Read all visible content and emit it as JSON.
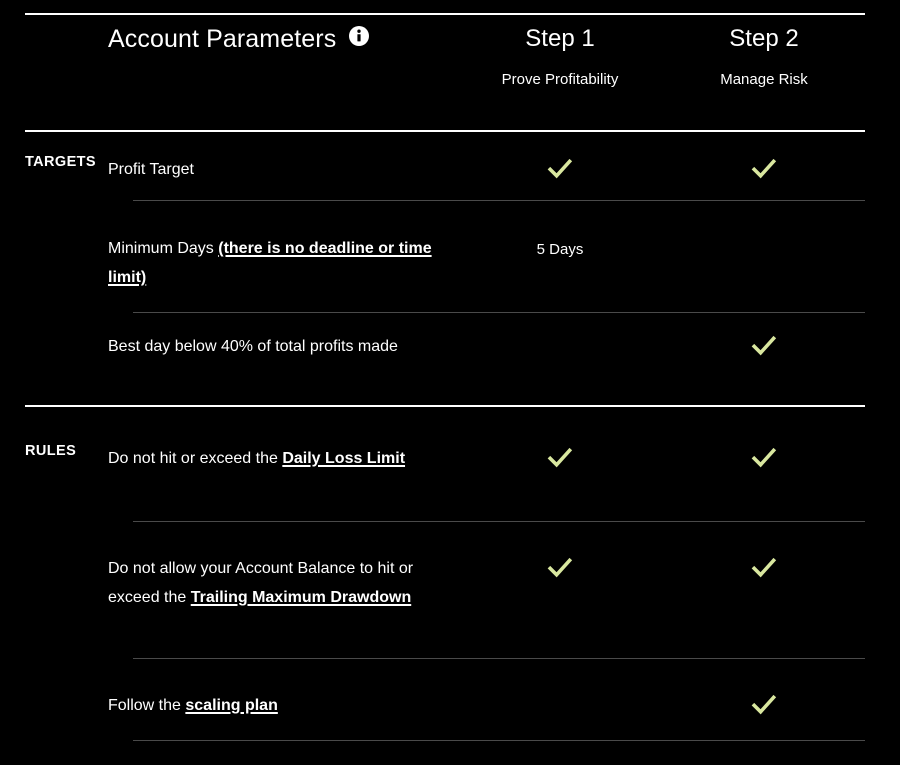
{
  "header": {
    "title": "Account Parameters",
    "info_icon": "info-icon",
    "columns": [
      {
        "title": "Step 1",
        "subtitle": "Prove Profitability"
      },
      {
        "title": "Step 2",
        "subtitle": "Manage Risk"
      }
    ]
  },
  "colors": {
    "background": "#000000",
    "text": "#ffffff",
    "check": "#d9e79f",
    "rule_bright": "#ffffff",
    "rule_dim": "#4a4a4a"
  },
  "sections": [
    {
      "label": "TARGETS",
      "rows": [
        {
          "parts": [
            {
              "text": "Profit Target",
              "link": false
            }
          ],
          "step1": {
            "type": "check",
            "icon": "check-icon"
          },
          "step2": {
            "type": "check",
            "icon": "check-icon"
          }
        },
        {
          "parts": [
            {
              "text": "Minimum Days ",
              "link": false
            },
            {
              "text": "(there is no deadline or time limit)",
              "link": true
            }
          ],
          "step1": {
            "type": "text",
            "value": "5 Days"
          },
          "step2": {
            "type": "empty"
          }
        },
        {
          "parts": [
            {
              "text": "Best day below 40% of total profits made",
              "link": false
            }
          ],
          "step1": {
            "type": "empty"
          },
          "step2": {
            "type": "check",
            "icon": "check-icon"
          }
        }
      ]
    },
    {
      "label": "RULES",
      "rows": [
        {
          "parts": [
            {
              "text": "Do not hit or exceed the ",
              "link": false
            },
            {
              "text": "Daily Loss Limit",
              "link": true
            }
          ],
          "step1": {
            "type": "check",
            "icon": "check-icon"
          },
          "step2": {
            "type": "check",
            "icon": "check-icon"
          }
        },
        {
          "parts": [
            {
              "text": "Do not allow your Account Balance to hit or exceed the ",
              "link": false
            },
            {
              "text": "Trailing Maximum Drawdown",
              "link": true
            }
          ],
          "step1": {
            "type": "check",
            "icon": "check-icon"
          },
          "step2": {
            "type": "check",
            "icon": "check-icon"
          }
        },
        {
          "parts": [
            {
              "text": "Follow the ",
              "link": false
            },
            {
              "text": "scaling plan",
              "link": true
            }
          ],
          "step1": {
            "type": "empty"
          },
          "step2": {
            "type": "check",
            "icon": "check-icon"
          }
        }
      ]
    }
  ]
}
